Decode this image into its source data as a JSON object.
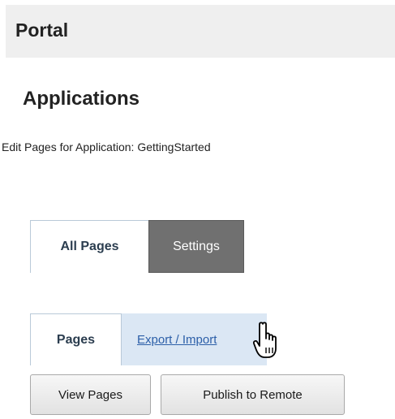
{
  "header": {
    "portal_title": "Portal"
  },
  "main": {
    "page_title": "Applications",
    "subtitle": "Edit Pages for Application: GettingStarted"
  },
  "primary_tabs": [
    {
      "label": "All Pages",
      "active": true
    },
    {
      "label": "Settings",
      "active": false
    }
  ],
  "secondary_tabs": [
    {
      "label": "Pages",
      "active": true
    },
    {
      "label": "Export / Import",
      "active": false
    }
  ],
  "buttons": {
    "view_pages": "View Pages",
    "publish_to_remote": "Publish to Remote"
  },
  "cursor": {
    "icon": "hand-pointer-icon"
  },
  "colors": {
    "header_bg": "#efefef",
    "dark_tab_bg": "#707070",
    "link_tab_bg": "#dbe7f4",
    "link_color": "#2c5fa8"
  }
}
